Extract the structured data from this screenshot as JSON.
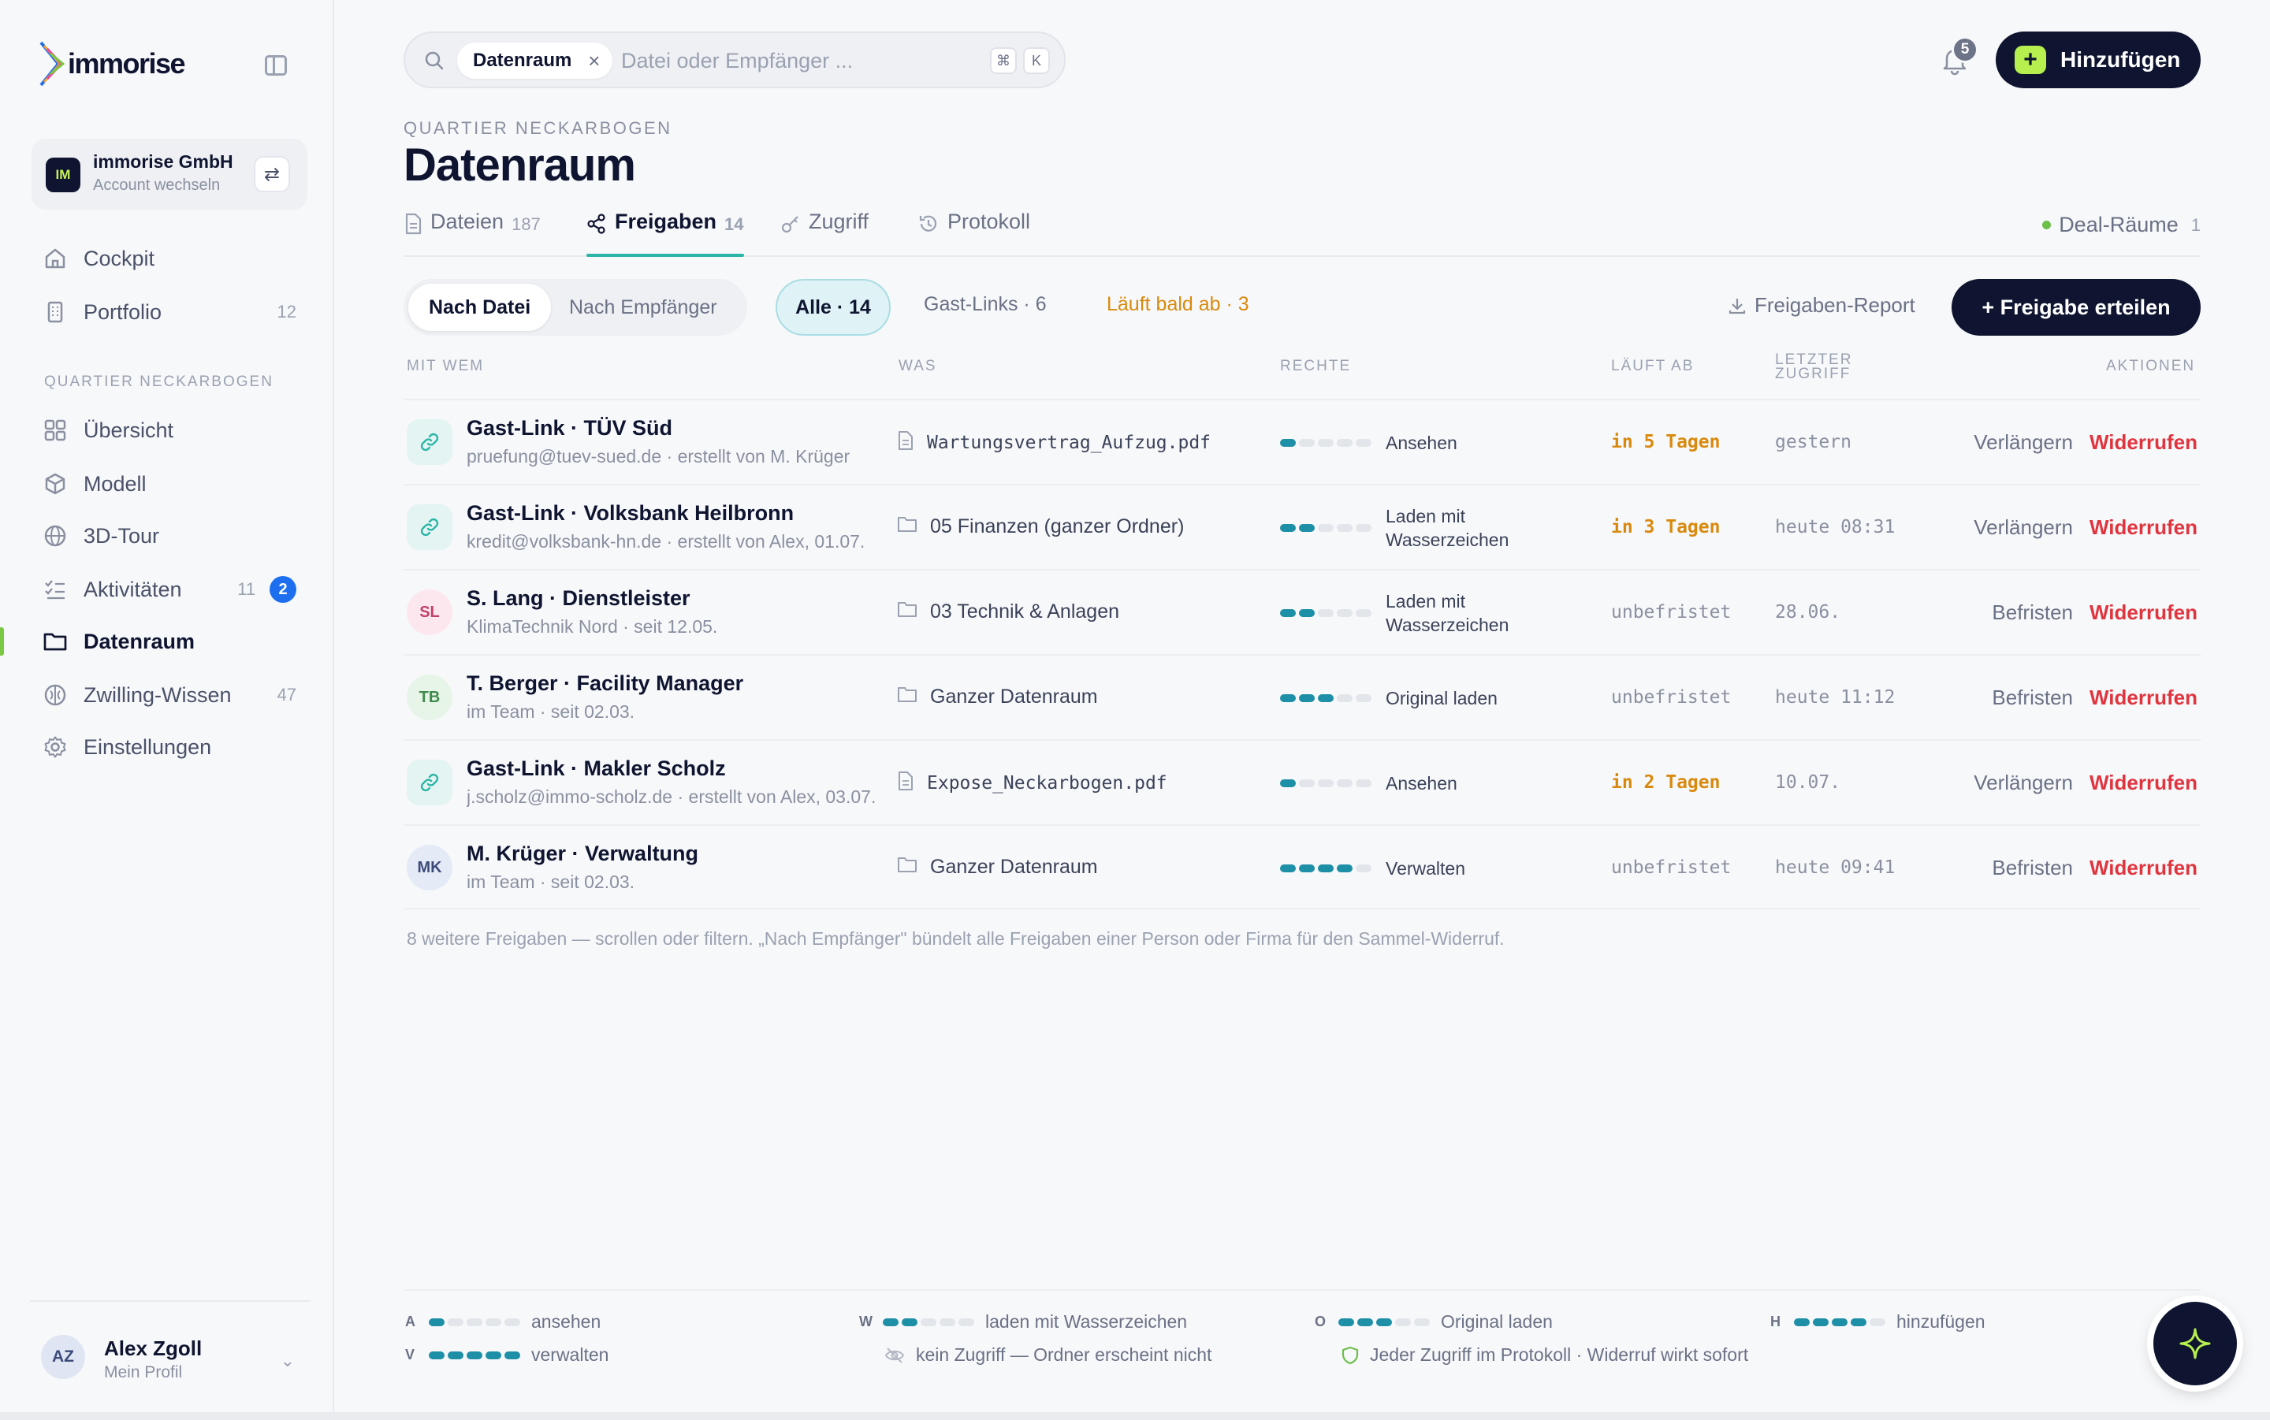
{
  "app": {
    "logo_text": "immorise"
  },
  "account": {
    "badge": "IM",
    "name": "immorise GmbH",
    "sub": "Account wechseln"
  },
  "nav": {
    "cockpit": {
      "label": "Cockpit"
    },
    "portfolio": {
      "label": "Portfolio",
      "count": "12"
    },
    "section": "QUARTIER NECKARBOGEN",
    "uebersicht": {
      "label": "Übersicht"
    },
    "modell": {
      "label": "Modell"
    },
    "tour": {
      "label": "3D-Tour"
    },
    "aktivitaeten": {
      "label": "Aktivitäten",
      "count": "11",
      "badge": "2"
    },
    "datenraum": {
      "label": "Datenraum"
    },
    "zwilling": {
      "label": "Zwilling-Wissen",
      "count": "47"
    },
    "einstellungen": {
      "label": "Einstellungen"
    }
  },
  "profile": {
    "initials": "AZ",
    "name": "Alex Zgoll",
    "sub": "Mein Profil"
  },
  "search": {
    "chip": "Datenraum",
    "placeholder": "Datei oder Empfänger ...",
    "kbd1": "⌘",
    "kbd2": "K"
  },
  "header": {
    "notifications": "5",
    "add_label": "Hinzufügen",
    "add_plus": "+"
  },
  "page": {
    "eyebrow": "QUARTIER NECKARBOGEN",
    "title": "Datenraum"
  },
  "tabs": [
    {
      "label": "Dateien",
      "count": "187"
    },
    {
      "label": "Freigaben",
      "count": "14"
    },
    {
      "label": "Zugriff"
    },
    {
      "label": "Protokoll"
    }
  ],
  "deal": {
    "label": "Deal-Räume",
    "count": "1"
  },
  "toolbar": {
    "seg_file": "Nach Datei",
    "seg_recipient": "Nach Empfänger",
    "filter_all": "Alle · 14",
    "filter_guest": "Gast-Links · 6",
    "filter_expiring": "Läuft bald ab · 3",
    "report": "Freigaben-Report",
    "grant": "+  Freigabe erteilen"
  },
  "table": {
    "headers": {
      "who": "MIT WEM",
      "what": "WAS",
      "rights": "RECHTE",
      "expires": "LÄUFT AB",
      "last": "LETZTER ZUGRIFF",
      "actions": "AKTIONEN"
    },
    "rows": [
      {
        "icon": "link-icon",
        "initials": "",
        "name": "Gast-Link · TÜV Süd",
        "sub": "pruefung@tuev-sued.de · erstellt von M. Krüger",
        "what_type": "file",
        "what": "Wartungsvertrag_Aufzug.pdf",
        "level": 1,
        "rights": "Ansehen",
        "expires": "in 5 Tagen",
        "last": "gestern",
        "action1": "Verlängern",
        "action2": "Widerrufen"
      },
      {
        "icon": "link-icon",
        "initials": "",
        "name": "Gast-Link · Volksbank Heilbronn",
        "sub": "kredit@volksbank-hn.de · erstellt von Alex, 01.07.",
        "what_type": "folder",
        "what": "05 Finanzen (ganzer Ordner)",
        "level": 2,
        "rights": "Laden mit Wasserzeichen",
        "expires": "in 3 Tagen",
        "last": "heute 08:31",
        "action1": "Verlängern",
        "action2": "Widerrufen"
      },
      {
        "icon": "avatar",
        "initials": "SL",
        "name": "S. Lang · Dienstleister",
        "sub": "KlimaTechnik Nord · seit 12.05.",
        "what_type": "folder",
        "what": "03 Technik & Anlagen",
        "level": 2,
        "rights": "Laden mit Wasserzeichen",
        "expires": "unbefristet",
        "last": "28.06.",
        "action1": "Befristen",
        "action2": "Widerrufen"
      },
      {
        "icon": "avatar",
        "initials": "TB",
        "name": "T. Berger · Facility Manager",
        "sub": "im Team · seit 02.03.",
        "what_type": "folder",
        "what": "Ganzer Datenraum",
        "level": 3,
        "rights": "Original laden",
        "expires": "unbefristet",
        "last": "heute 11:12",
        "action1": "Befristen",
        "action2": "Widerrufen"
      },
      {
        "icon": "link-icon",
        "initials": "",
        "name": "Gast-Link · Makler Scholz",
        "sub": "j.scholz@immo-scholz.de · erstellt von Alex, 03.07.",
        "what_type": "file",
        "what": "Expose_Neckarbogen.pdf",
        "level": 1,
        "rights": "Ansehen",
        "expires": "in 2 Tagen",
        "last": "10.07.",
        "action1": "Verlängern",
        "action2": "Widerrufen"
      },
      {
        "icon": "avatar",
        "initials": "MK",
        "name": "M. Krüger · Verwaltung",
        "sub": "im Team · seit 02.03.",
        "what_type": "folder",
        "what": "Ganzer Datenraum",
        "level": 4,
        "rights": "Verwalten",
        "expires": "unbefristet",
        "last": "heute 09:41",
        "action1": "Befristen",
        "action2": "Widerrufen"
      }
    ],
    "footnote": "8 weitere Freigaben — scrollen oder filtern. „Nach Empfänger\" bündelt alle Freigaben einer Person oder Firma für den Sammel-Widerruf."
  },
  "legend": {
    "a": {
      "key": "A",
      "label": "ansehen",
      "level": 1
    },
    "w": {
      "key": "W",
      "label": "laden mit Wasserzeichen",
      "level": 2
    },
    "o": {
      "key": "O",
      "label": "Original laden",
      "level": 3
    },
    "h": {
      "key": "H",
      "label": "hinzufügen",
      "level": 4
    },
    "v": {
      "key": "V",
      "label": "verwalten",
      "level": 5
    },
    "none": "kein Zugriff — Ordner erscheint nicht",
    "audit": "Jeder Zugriff im Protokoll · Widerruf wirkt sofort"
  },
  "colors": {
    "navy": "#0f1530",
    "accent_green": "#b6ef4e",
    "teal": "#1d8fa6",
    "warn": "#d98a0e",
    "danger": "#e0353f",
    "active_marker": "#7ac943"
  }
}
